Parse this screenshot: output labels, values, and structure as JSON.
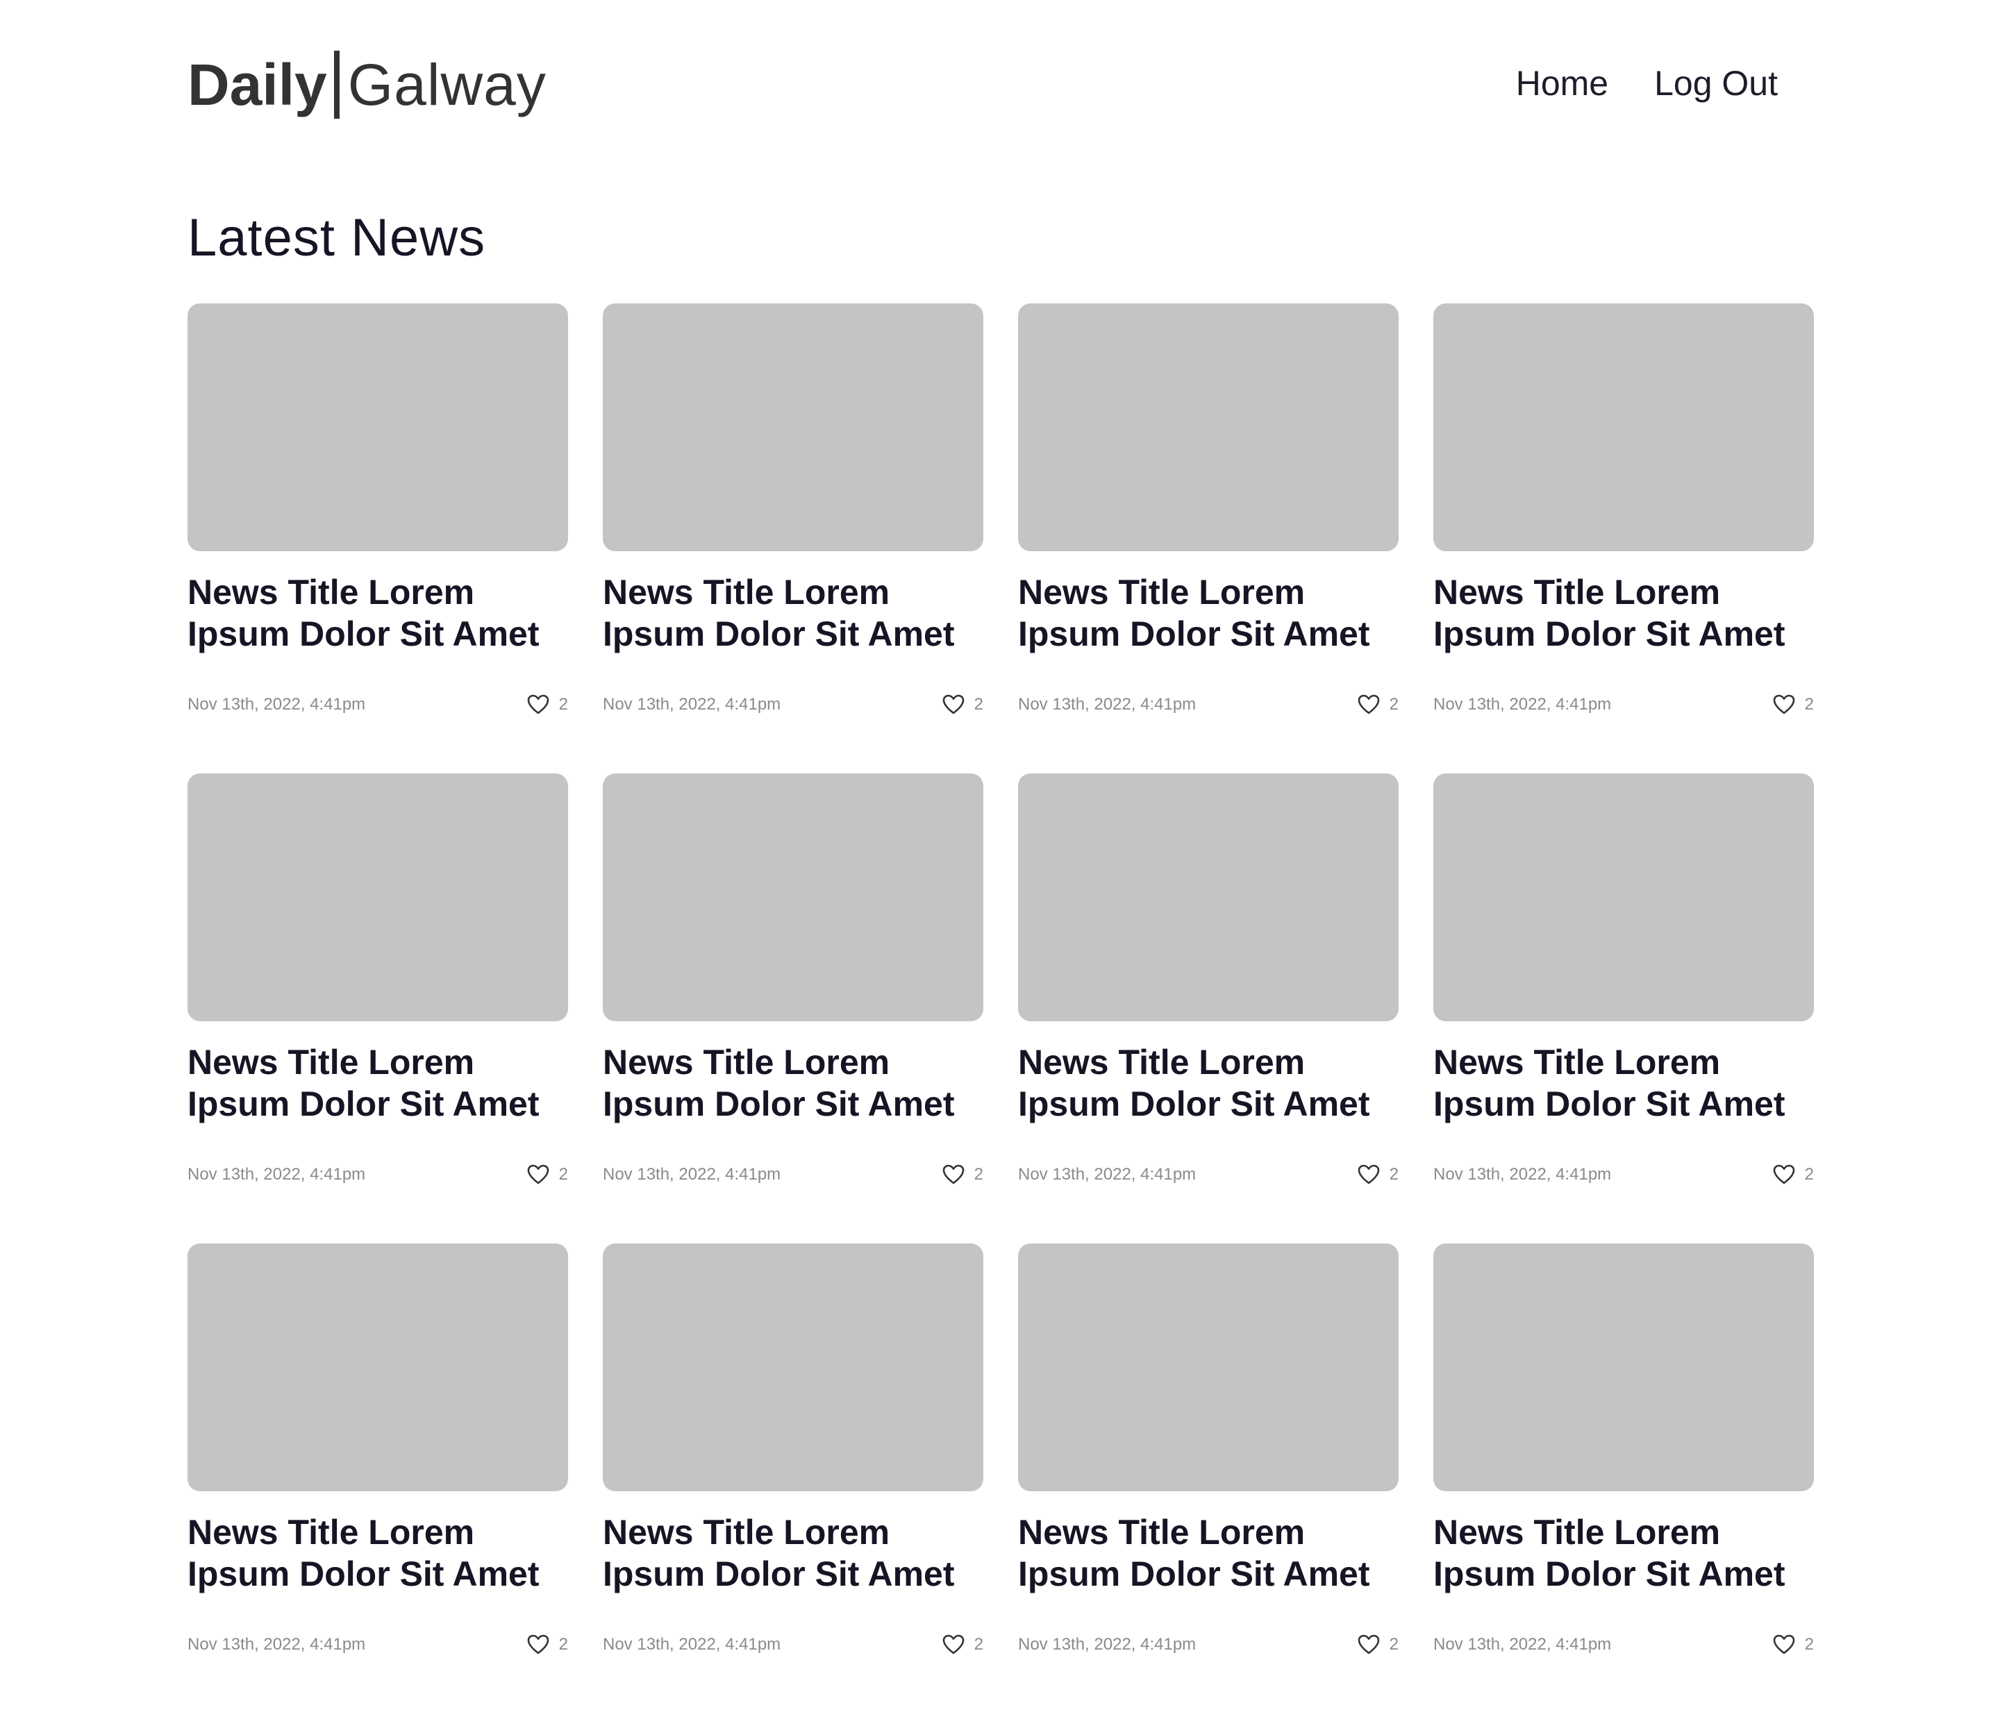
{
  "header": {
    "logo_bold": "Daily",
    "logo_light": "Galway",
    "nav": [
      {
        "label": "Home"
      },
      {
        "label": "Log Out"
      }
    ]
  },
  "main": {
    "title": "Latest News",
    "articles": [
      {
        "title_line1": "News Title Lorem",
        "title_line2": "Ipsum Dolor Sit Amet",
        "date": "Nov 13th, 2022, 4:41pm",
        "likes": "2"
      },
      {
        "title_line1": "News Title Lorem",
        "title_line2": "Ipsum Dolor Sit Amet",
        "date": "Nov 13th, 2022, 4:41pm",
        "likes": "2"
      },
      {
        "title_line1": "News Title Lorem",
        "title_line2": "Ipsum Dolor Sit Amet",
        "date": "Nov 13th, 2022, 4:41pm",
        "likes": "2"
      },
      {
        "title_line1": "News Title Lorem",
        "title_line2": "Ipsum Dolor Sit Amet",
        "date": "Nov 13th, 2022, 4:41pm",
        "likes": "2"
      },
      {
        "title_line1": "News Title Lorem",
        "title_line2": "Ipsum Dolor Sit Amet",
        "date": "Nov 13th, 2022, 4:41pm",
        "likes": "2"
      },
      {
        "title_line1": "News Title Lorem",
        "title_line2": "Ipsum Dolor Sit Amet",
        "date": "Nov 13th, 2022, 4:41pm",
        "likes": "2"
      },
      {
        "title_line1": "News Title Lorem",
        "title_line2": "Ipsum Dolor Sit Amet",
        "date": "Nov 13th, 2022, 4:41pm",
        "likes": "2"
      },
      {
        "title_line1": "News Title Lorem",
        "title_line2": "Ipsum Dolor Sit Amet",
        "date": "Nov 13th, 2022, 4:41pm",
        "likes": "2"
      },
      {
        "title_line1": "News Title Lorem",
        "title_line2": "Ipsum Dolor Sit Amet",
        "date": "Nov 13th, 2022, 4:41pm",
        "likes": "2"
      },
      {
        "title_line1": "News Title Lorem",
        "title_line2": "Ipsum Dolor Sit Amet",
        "date": "Nov 13th, 2022, 4:41pm",
        "likes": "2"
      },
      {
        "title_line1": "News Title Lorem",
        "title_line2": "Ipsum Dolor Sit Amet",
        "date": "Nov 13th, 2022, 4:41pm",
        "likes": "2"
      },
      {
        "title_line1": "News Title Lorem",
        "title_line2": "Ipsum Dolor Sit Amet",
        "date": "Nov 13th, 2022, 4:41pm",
        "likes": "2"
      }
    ]
  },
  "colors": {
    "thumbnail_placeholder": "#c4c4c4",
    "text_primary": "#151525",
    "text_meta": "#8a8a8a",
    "logo": "#333333"
  },
  "icons": {
    "like": "heart-icon"
  }
}
